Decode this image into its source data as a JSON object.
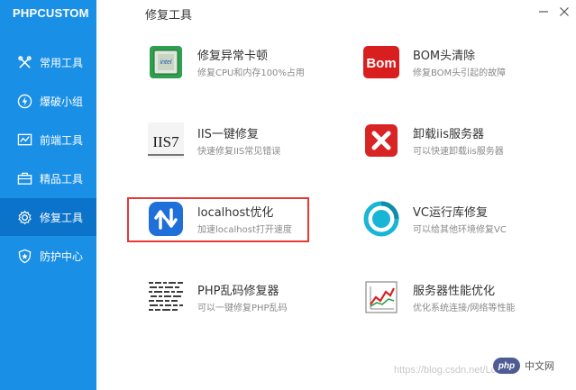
{
  "app": {
    "brand": "PHPCUSTOM",
    "page_title": "修复工具"
  },
  "sidebar": {
    "items": [
      {
        "label": "常用工具",
        "icon": "tools-icon"
      },
      {
        "label": "爆破小组",
        "icon": "lightning-icon"
      },
      {
        "label": "前端工具",
        "icon": "chart-icon"
      },
      {
        "label": "精品工具",
        "icon": "briefcase-icon"
      },
      {
        "label": "修复工具",
        "icon": "gear-icon",
        "active": true
      },
      {
        "label": "防护中心",
        "icon": "shield-icon"
      }
    ]
  },
  "tools": [
    {
      "name": "修复异常卡顿",
      "desc": "修复CPU和内存100%占用",
      "icon": "cpu-chip-icon"
    },
    {
      "name": "BOM头清除",
      "desc": "修复BOM头引起的故障",
      "icon": "bom-icon",
      "icon_text": "Bom"
    },
    {
      "name": "IIS一键修复",
      "desc": "快速修复IIS常见错误",
      "icon": "iis7-icon",
      "icon_text": "IIS7"
    },
    {
      "name": "卸载iis服务器",
      "desc": "可以快速卸载iis服务器",
      "icon": "uninstall-x-icon"
    },
    {
      "name": "localhost优化",
      "desc": "加速localhost打开速度",
      "icon": "arrows-updown-icon"
    },
    {
      "name": "VC运行库修复",
      "desc": "可以给其他环境修复VC",
      "icon": "vc-ring-icon"
    },
    {
      "name": "PHP乱码修复器",
      "desc": "可以一键修复PHP乱码",
      "icon": "garbled-text-icon"
    },
    {
      "name": "服务器性能优化",
      "desc": "优化系统连接/网络等性能",
      "icon": "performance-chart-icon"
    }
  ],
  "watermark": {
    "url_text": "https://blog.csdn.net/Lccee",
    "php_logo": "php",
    "site_cn": "中文网"
  },
  "colors": {
    "sidebar": "#1a8fe6",
    "sidebar_active": "#0b73c9",
    "highlight": "#e53935"
  }
}
